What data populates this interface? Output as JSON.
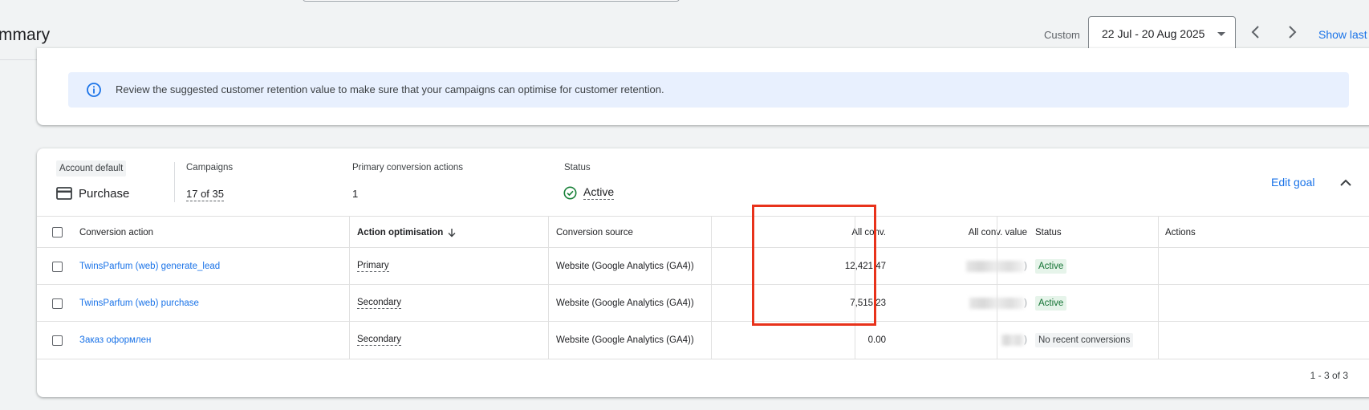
{
  "header": {
    "page_title": "mmary",
    "date_label": "Custom",
    "date_range": "22 Jul - 20 Aug 2025",
    "show_last": "Show last"
  },
  "banner": {
    "text": "Review the suggested customer retention value to make sure that your campaigns can optimise for customer retention."
  },
  "goal": {
    "account_default": "Account default",
    "name": "Purchase",
    "campaigns_label": "Campaigns",
    "campaigns_value": "17 of 35",
    "primary_label": "Primary conversion actions",
    "primary_value": "1",
    "status_label": "Status",
    "status_value": "Active",
    "edit_label": "Edit goal"
  },
  "table": {
    "headers": {
      "action": "Conversion action",
      "optimisation": "Action optimisation",
      "source": "Conversion source",
      "all_conv": "All conv.",
      "all_conv_value": "All conv. value",
      "status": "Status",
      "actions": "Actions"
    },
    "rows": [
      {
        "action": "TwinsParfum (web) generate_lead",
        "optimisation": "Primary",
        "source": "Website (Google Analytics (GA4))",
        "all_conv": "12,421.47",
        "all_conv_value_suffix": ")",
        "status": "Active"
      },
      {
        "action": "TwinsParfum (web) purchase",
        "optimisation": "Secondary",
        "source": "Website (Google Analytics (GA4))",
        "all_conv": "7,515.23",
        "all_conv_value_suffix": ")",
        "status": "Active"
      },
      {
        "action": "Заказ оформлен",
        "optimisation": "Secondary",
        "source": "Website (Google Analytics (GA4))",
        "all_conv": "0.00",
        "all_conv_value_suffix": ")",
        "status": "No recent conversions"
      }
    ],
    "pagination": "1 - 3 of 3"
  },
  "colors": {
    "link": "#1a73e8",
    "active_chip_bg": "#e6f4ea",
    "active_chip_text": "#137333",
    "banner_bg": "#e8f0fe",
    "highlight": "#e8321b"
  },
  "icons": {
    "banner": "info-icon",
    "goal": "credit-card-icon",
    "status": "check-circle-icon",
    "sort": "arrow-down-icon",
    "collapse": "chevron-up-icon"
  }
}
